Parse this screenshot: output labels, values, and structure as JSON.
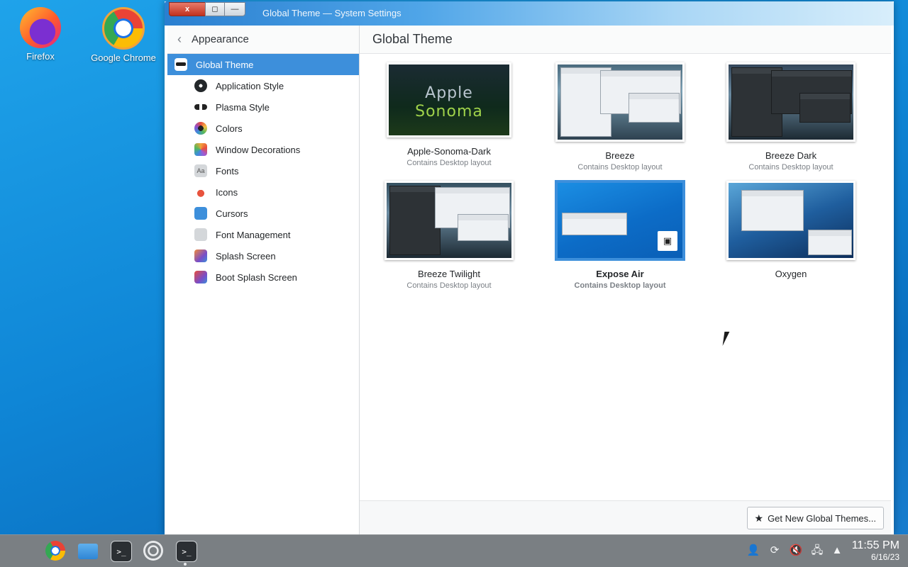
{
  "desktop": {
    "icons": [
      {
        "label": "Firefox"
      },
      {
        "label": "Google Chrome"
      }
    ]
  },
  "window": {
    "title": "Global Theme — System Settings",
    "controls": {
      "close": "x",
      "maximize": "◻",
      "minimize": "—"
    }
  },
  "sidebar": {
    "header": "Appearance",
    "items": [
      {
        "label": "Global Theme",
        "icon": "global-theme-icon"
      },
      {
        "label": "Application Style",
        "icon": "application-style-icon"
      },
      {
        "label": "Plasma Style",
        "icon": "plasma-style-icon"
      },
      {
        "label": "Colors",
        "icon": "colors-icon"
      },
      {
        "label": "Window Decorations",
        "icon": "window-decorations-icon"
      },
      {
        "label": "Fonts",
        "icon": "fonts-icon"
      },
      {
        "label": "Icons",
        "icon": "icons-icon"
      },
      {
        "label": "Cursors",
        "icon": "cursors-icon"
      },
      {
        "label": "Font Management",
        "icon": "font-management-icon"
      },
      {
        "label": "Splash Screen",
        "icon": "splash-screen-icon"
      },
      {
        "label": "Boot Splash Screen",
        "icon": "boot-splash-icon"
      }
    ]
  },
  "main": {
    "title": "Global Theme",
    "themes": [
      {
        "name": "Apple-Sonoma-Dark",
        "sub": "Contains Desktop layout",
        "preview_text": [
          "Apple",
          "Sonoma"
        ]
      },
      {
        "name": "Breeze",
        "sub": "Contains Desktop layout"
      },
      {
        "name": "Breeze Dark",
        "sub": "Contains Desktop layout"
      },
      {
        "name": "Breeze Twilight",
        "sub": "Contains Desktop layout"
      },
      {
        "name": "Expose Air",
        "sub": "Contains Desktop layout",
        "selected": true
      },
      {
        "name": "Oxygen",
        "sub": ""
      }
    ],
    "get_new_button": "Get New Global Themes..."
  },
  "taskbar": {
    "clock_time": "11:55 PM",
    "clock_date": "6/16/23"
  },
  "colors": {
    "accent": "#3d8fdb",
    "taskbar": "#7a7f83"
  }
}
